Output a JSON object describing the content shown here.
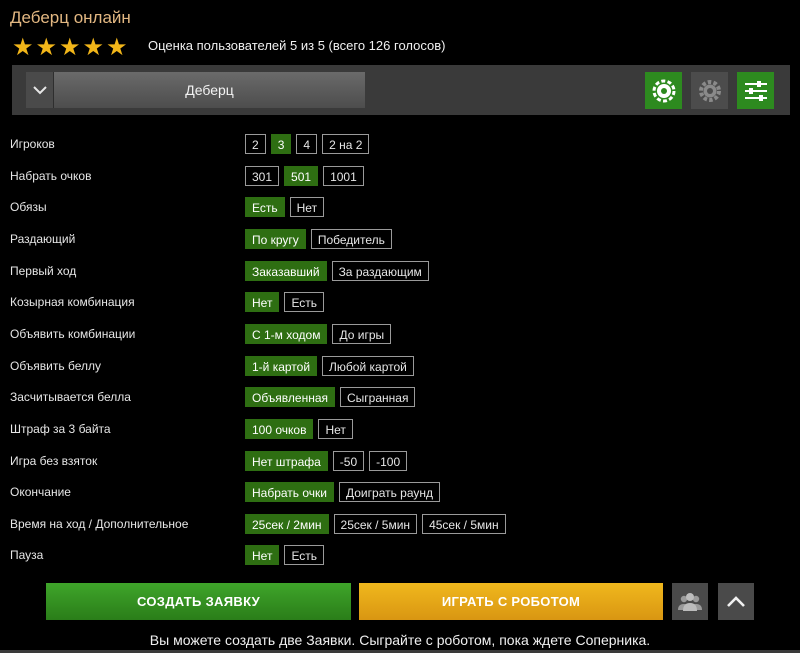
{
  "title": "Деберц онлайн",
  "rating": {
    "stars": 5,
    "prefix": "Оценка пользователей ",
    "score": "5",
    "middle": " из 5 (всего ",
    "votes": "126",
    "suffix": " голосов)"
  },
  "toolbar": {
    "game_select": "Деберц",
    "icons": [
      "settings-gear-icon",
      "gear-icon",
      "sliders-icon"
    ]
  },
  "options": [
    {
      "label": "Игроков",
      "values": [
        "2",
        "3",
        "4",
        "2 на 2"
      ],
      "selected": 1
    },
    {
      "label": "Набрать очков",
      "values": [
        "301",
        "501",
        "1001"
      ],
      "selected": 1
    },
    {
      "label": "Обязы",
      "values": [
        "Есть",
        "Нет"
      ],
      "selected": 0
    },
    {
      "label": "Раздающий",
      "values": [
        "По кругу",
        "Победитель"
      ],
      "selected": 0
    },
    {
      "label": "Первый ход",
      "values": [
        "Заказавший",
        "За раздающим"
      ],
      "selected": 0
    },
    {
      "label": "Козырная комбинация",
      "values": [
        "Нет",
        "Есть"
      ],
      "selected": 0
    },
    {
      "label": "Объявить комбинации",
      "values": [
        "С 1-м ходом",
        "До игры"
      ],
      "selected": 0
    },
    {
      "label": "Объявить беллу",
      "values": [
        "1-й картой",
        "Любой картой"
      ],
      "selected": 0
    },
    {
      "label": "Засчитывается белла",
      "values": [
        "Объявленная",
        "Сыгранная"
      ],
      "selected": 0
    },
    {
      "label": "Штраф за 3 байта",
      "values": [
        "100 очков",
        "Нет"
      ],
      "selected": 0
    },
    {
      "label": "Игра без взяток",
      "values": [
        "Нет штрафа",
        "-50",
        "-100"
      ],
      "selected": 0
    },
    {
      "label": "Окончание",
      "values": [
        "Набрать очки",
        "Доиграть раунд"
      ],
      "selected": 0
    },
    {
      "label": "Время на ход / Дополнительное",
      "values": [
        "25сек / 2мин",
        "25сек / 5мин",
        "45сек / 5мин"
      ],
      "selected": 0
    },
    {
      "label": "Пауза",
      "values": [
        "Нет",
        "Есть"
      ],
      "selected": 0
    }
  ],
  "actions": {
    "create": "СОЗДАТЬ ЗАЯВКУ",
    "robot": "ИГРАТЬ С РОБОТОМ"
  },
  "footer": "Вы можете создать две Заявки. Сыграйте с роботом, пока ждете Соперника.",
  "colors": {
    "selected": "#2e6e12",
    "create": "#3a9a26",
    "robot": "#eab01a",
    "title": "#e3b882",
    "star": "#f2b619"
  }
}
